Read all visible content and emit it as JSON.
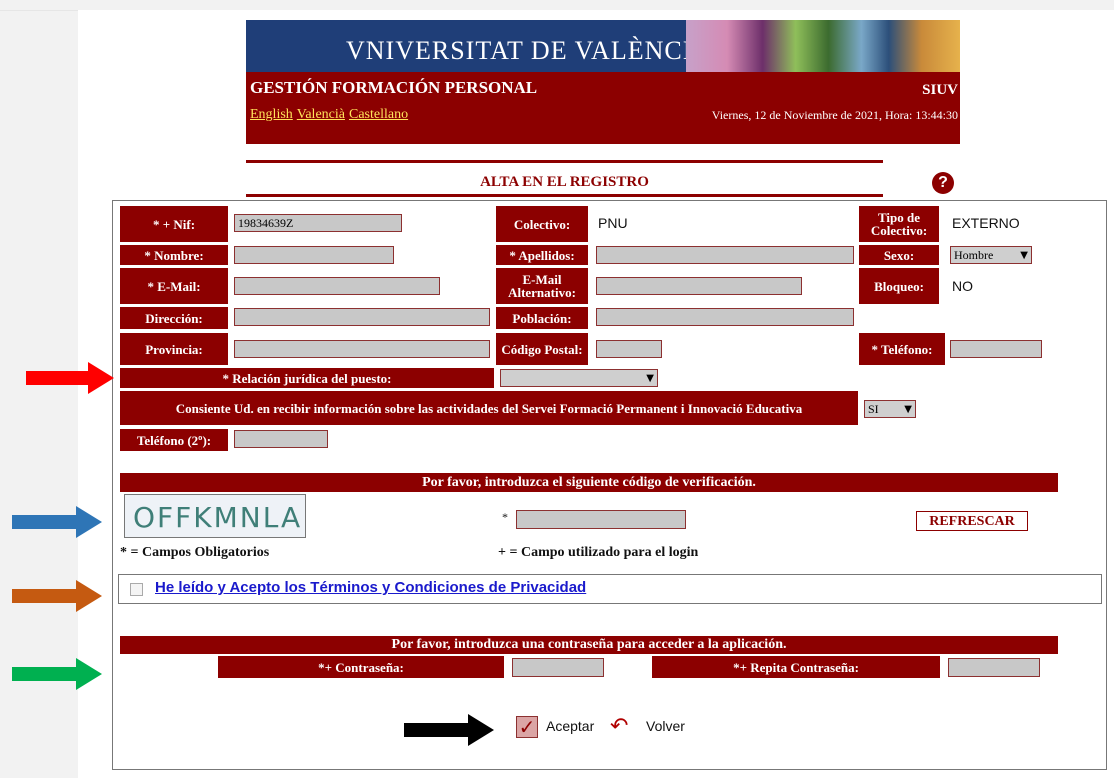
{
  "header": {
    "logo_text": "VNIVERSITAT DE VALÈNCIA",
    "app_title": "GESTIÓN FORMACIÓN PERSONAL",
    "app_code": "SIUV",
    "languages": [
      "English",
      "Valencià",
      "Castellano"
    ],
    "datetime": "Viernes, 12 de Noviembre de 2021, Hora:  13:44:30"
  },
  "section_title": "ALTA EN EL REGISTRO",
  "help_icon": "?",
  "form": {
    "nif_label": "* + Nif:",
    "nif_value": "19834639Z",
    "colectivo_label": "Colectivo:",
    "colectivo_value": "PNU",
    "tipo_colectivo_label": "Tipo de Colectivo:",
    "tipo_colectivo_value": "EXTERNO",
    "nombre_label": "* Nombre:",
    "apellidos_label": "* Apellidos:",
    "sexo_label": "Sexo:",
    "sexo_value": "Hombre",
    "email_label": "* E-Mail:",
    "email_alt_label": "E-Mail Alternativo:",
    "bloqueo_label": "Bloqueo:",
    "bloqueo_value": "NO",
    "direccion_label": "Dirección:",
    "poblacion_label": "Población:",
    "provincia_label": "Provincia:",
    "codigo_postal_label": "Código Postal:",
    "telefono_label": "* Teléfono:",
    "relacion_label": "* Relación jurídica del puesto:",
    "relacion_value": "",
    "consiente_label": "Consiente Ud. en recibir información sobre las actividades del Servei Formació Permanent i Innovació Educativa",
    "consiente_value": "SI",
    "telefono2_label": "Teléfono (2º):"
  },
  "verification": {
    "banner": "Por favor, introduzca el siguiente código de verificación.",
    "captcha_text": "OFFKMNLA",
    "asterisk": "*",
    "refresh_label": "REFRESCAR",
    "legend_required": "* = Campos Obligatorios",
    "legend_login": "+ = Campo utilizado para el login"
  },
  "terms": {
    "label": "He leído y Acepto los Términos y Condiciones de Privacidad",
    "checked": false
  },
  "password": {
    "banner": "Por favor, introduzca una contraseña para acceder a la aplicación.",
    "password_label": "*+ Contraseña:",
    "repeat_label": "*+ Repita Contraseña:"
  },
  "actions": {
    "accept_label": "Aceptar",
    "back_label": "Volver"
  },
  "annotations": {
    "arrow_colors": [
      "#ff0000",
      "#2e75b6",
      "#c55a11",
      "#00b050",
      "#000000"
    ]
  }
}
